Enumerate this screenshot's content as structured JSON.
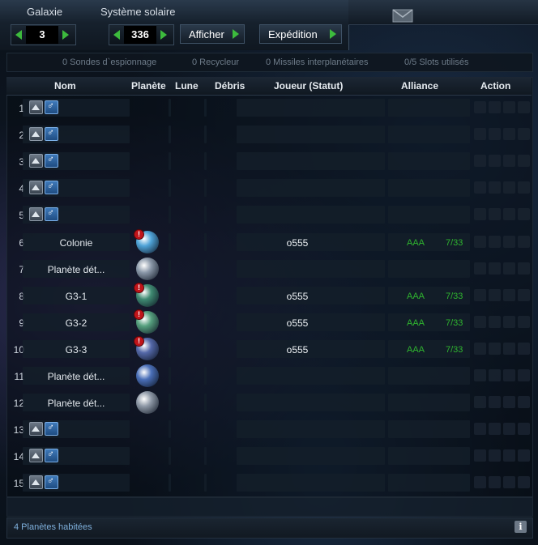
{
  "nav": {
    "galaxy_label": "Galaxie",
    "galaxy_value": "3",
    "system_label": "Système solaire",
    "system_value": "336",
    "show_button": "Afficher",
    "expedition_button": "Expédition"
  },
  "resources": {
    "probes": "0 Sondes d`espionnage",
    "recyclers": "0 Recycleur",
    "missiles": "0 Missiles interplanétaires",
    "slots": "0/5 Slots utilisés"
  },
  "table": {
    "headers": {
      "name": "Nom",
      "planet": "Planète",
      "moon": "Lune",
      "debris": "Débris",
      "player": "Joueur (Statut)",
      "alliance": "Alliance",
      "action": "Action"
    },
    "rows": [
      {
        "pos": "1",
        "name": "",
        "player": "",
        "alliance": "",
        "rank": "",
        "planet_color": "",
        "warning": false
      },
      {
        "pos": "2",
        "name": "",
        "player": "",
        "alliance": "",
        "rank": "",
        "planet_color": "",
        "warning": false
      },
      {
        "pos": "3",
        "name": "",
        "player": "",
        "alliance": "",
        "rank": "",
        "planet_color": "",
        "warning": false
      },
      {
        "pos": "4",
        "name": "",
        "player": "",
        "alliance": "",
        "rank": "",
        "planet_color": "",
        "warning": false
      },
      {
        "pos": "5",
        "name": "",
        "player": "",
        "alliance": "",
        "rank": "",
        "planet_color": "",
        "warning": false
      },
      {
        "pos": "6",
        "name": "Colonie",
        "player": "o555",
        "alliance": "AAA",
        "rank": "7/33",
        "planet_color": "#4fa3d8",
        "warning": true
      },
      {
        "pos": "7",
        "name": "Planète dét...",
        "player": "",
        "alliance": "",
        "rank": "",
        "planet_color": "#8a97a8",
        "warning": false
      },
      {
        "pos": "8",
        "name": "G3-1",
        "player": "o555",
        "alliance": "AAA",
        "rank": "7/33",
        "planet_color": "#3f8a72",
        "warning": true
      },
      {
        "pos": "9",
        "name": "G3-2",
        "player": "o555",
        "alliance": "AAA",
        "rank": "7/33",
        "planet_color": "#56a07e",
        "warning": true
      },
      {
        "pos": "10",
        "name": "G3-3",
        "player": "o555",
        "alliance": "AAA",
        "rank": "7/33",
        "planet_color": "#5468a8",
        "warning": true
      },
      {
        "pos": "11",
        "name": "Planète dét...",
        "player": "",
        "alliance": "",
        "rank": "",
        "planet_color": "#4a6fb8",
        "warning": false
      },
      {
        "pos": "12",
        "name": "Planète dét...",
        "player": "",
        "alliance": "",
        "rank": "",
        "planet_color": "#8e98a6",
        "warning": false
      },
      {
        "pos": "13",
        "name": "",
        "player": "",
        "alliance": "",
        "rank": "",
        "planet_color": "",
        "warning": false
      },
      {
        "pos": "14",
        "name": "",
        "player": "",
        "alliance": "",
        "rank": "",
        "planet_color": "",
        "warning": false
      },
      {
        "pos": "15",
        "name": "",
        "player": "",
        "alliance": "",
        "rank": "",
        "planet_color": "",
        "warning": false
      }
    ]
  },
  "footer": {
    "inhabited": "4 Planètes habitées"
  },
  "icons": {
    "mail": "envelope-icon",
    "empty_slot_send": "spaceship-icon",
    "empty_slot_colonize": "colonize-icon",
    "warning": "warning-icon",
    "info": "info-icon"
  },
  "colors": {
    "accent_green": "#3dbb3d",
    "alliance_green": "#2fb52f",
    "warning_red": "#c0141a"
  }
}
